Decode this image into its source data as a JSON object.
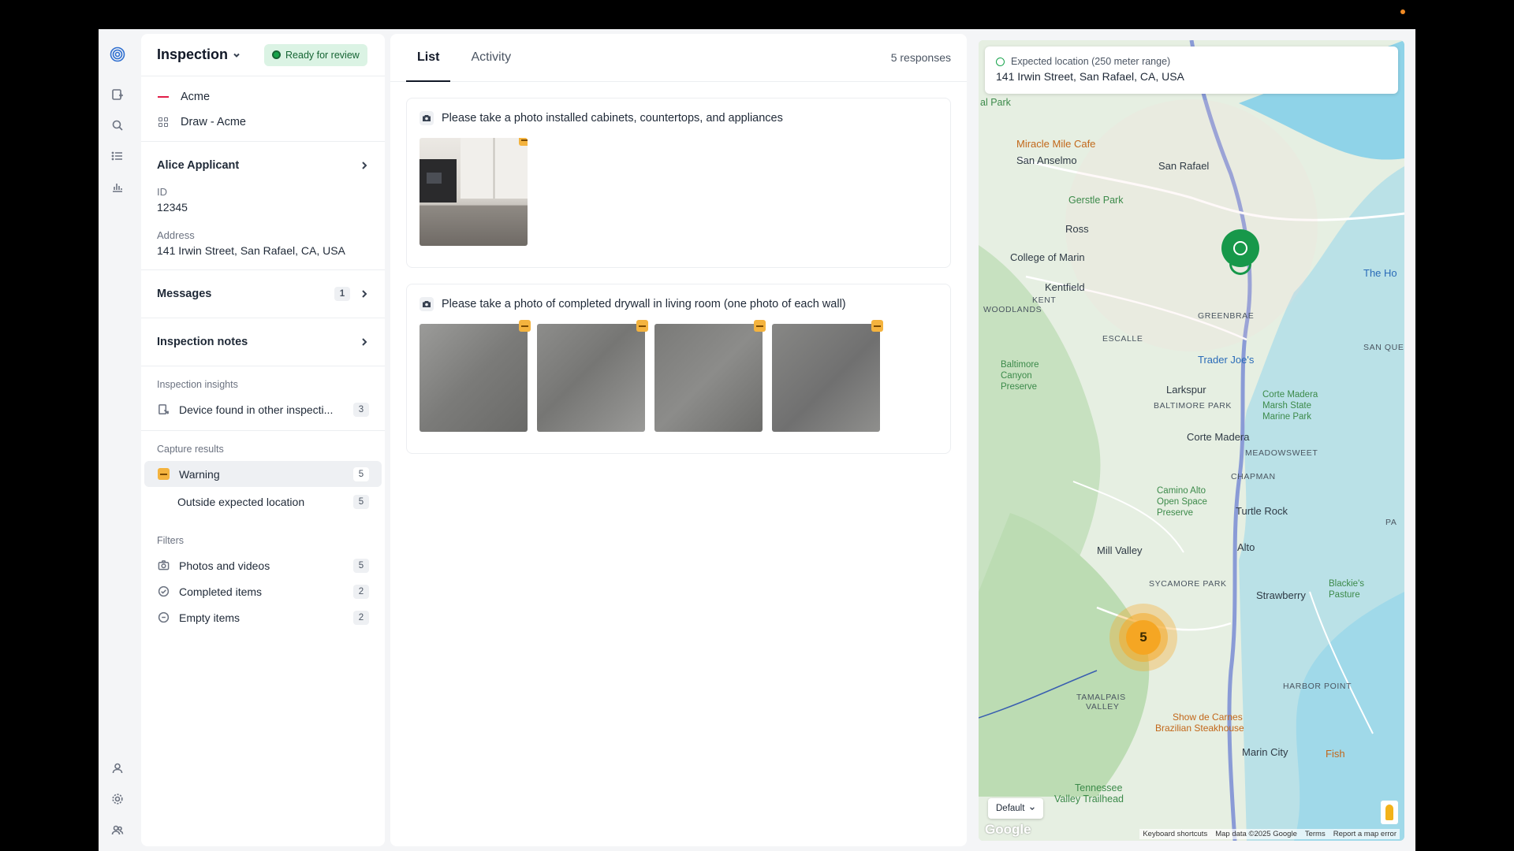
{
  "header": {
    "title": "Inspection",
    "status": "Ready for review"
  },
  "org": {
    "name": "Acme",
    "program": "Draw - Acme"
  },
  "applicant": {
    "name": "Alice Applicant",
    "id_label": "ID",
    "id_value": "12345",
    "address_label": "Address",
    "address_value": "141 Irwin Street, San Rafael, CA, USA"
  },
  "messages": {
    "label": "Messages",
    "count": "1"
  },
  "notes": {
    "label": "Inspection notes"
  },
  "insights": {
    "title": "Inspection insights",
    "items": [
      {
        "label": "Device found in other inspecti...",
        "count": "3"
      }
    ]
  },
  "capture": {
    "title": "Capture results",
    "warning": {
      "label": "Warning",
      "count": "5"
    },
    "sub": {
      "label": "Outside expected location",
      "count": "5"
    }
  },
  "filters": {
    "title": "Filters",
    "items": [
      {
        "label": "Photos and videos",
        "count": "5",
        "icon": "camera-icon"
      },
      {
        "label": "Completed items",
        "count": "2",
        "icon": "check-circle-icon"
      },
      {
        "label": "Empty items",
        "count": "2",
        "icon": "minus-circle-icon"
      }
    ]
  },
  "tabs": {
    "list": "List",
    "activity": "Activity",
    "responses": "5 responses"
  },
  "cards": [
    {
      "title": "Please take a photo installed cabinets, countertops, and appliances",
      "photos": 1
    },
    {
      "title": "Please take a photo of completed drywall in living room (one photo of each wall)",
      "photos": 4
    }
  ],
  "map": {
    "expected_label": "Expected location (250 meter range)",
    "expected_address": "141 Irwin Street, San Rafael, CA, USA",
    "cluster_count": "5",
    "map_type": "Default",
    "google": "Google",
    "attribution": [
      "Keyboard shortcuts",
      "Map data ©2025 Google",
      "Terms",
      "Report a map error"
    ],
    "labels": {
      "park": "al Park",
      "miracle": "Miracle Mile Cafe",
      "san_anselmo": "San Anselmo",
      "san_rafael": "San Rafael",
      "gerstle": "Gerstle Park",
      "ross": "Ross",
      "college": "College of Marin",
      "kentfield": "Kentfield",
      "kent_woodlands_1": "KENT",
      "kent_woodlands_2": "WOODLANDS",
      "greenbrae": "GREENBRAE",
      "escalle": "ESCALLE",
      "trader": "Trader Joe's",
      "baltimore1": "Baltimore",
      "baltimore2": "Canyon",
      "baltimore3": "Preserve",
      "larkspur": "Larkspur",
      "baltimore_park": "BALTIMORE PARK",
      "corte_madera": "Corte Madera",
      "marsh1": "Corte Madera",
      "marsh2": "Marsh State",
      "marsh3": "Marine Park",
      "meadowsweet": "MEADOWSWEET",
      "chapman": "CHAPMAN",
      "camino1": "Camino Alto",
      "camino2": "Open Space",
      "camino3": "Preserve",
      "turtle": "Turtle Rock",
      "mill_valley": "Mill Valley",
      "alto": "Alto",
      "sycamore": "SYCAMORE PARK",
      "strawberry": "Strawberry",
      "blackie1": "Blackie's",
      "blackie2": "Pasture",
      "tamalpais1": "TAMALPAIS",
      "tamalpais2": "VALLEY",
      "harbor": "HARBOR POINT",
      "show1": "Show de Carnes",
      "show2": "Brazilian Steakhouse",
      "marin_city": "Marin City",
      "fish": "Fish",
      "tennessee1": "Tennessee",
      "tennessee2": "Valley Trailhead",
      "the_ho": "The Ho",
      "san_quei": "SAN QUEI",
      "pa": "PA"
    }
  }
}
